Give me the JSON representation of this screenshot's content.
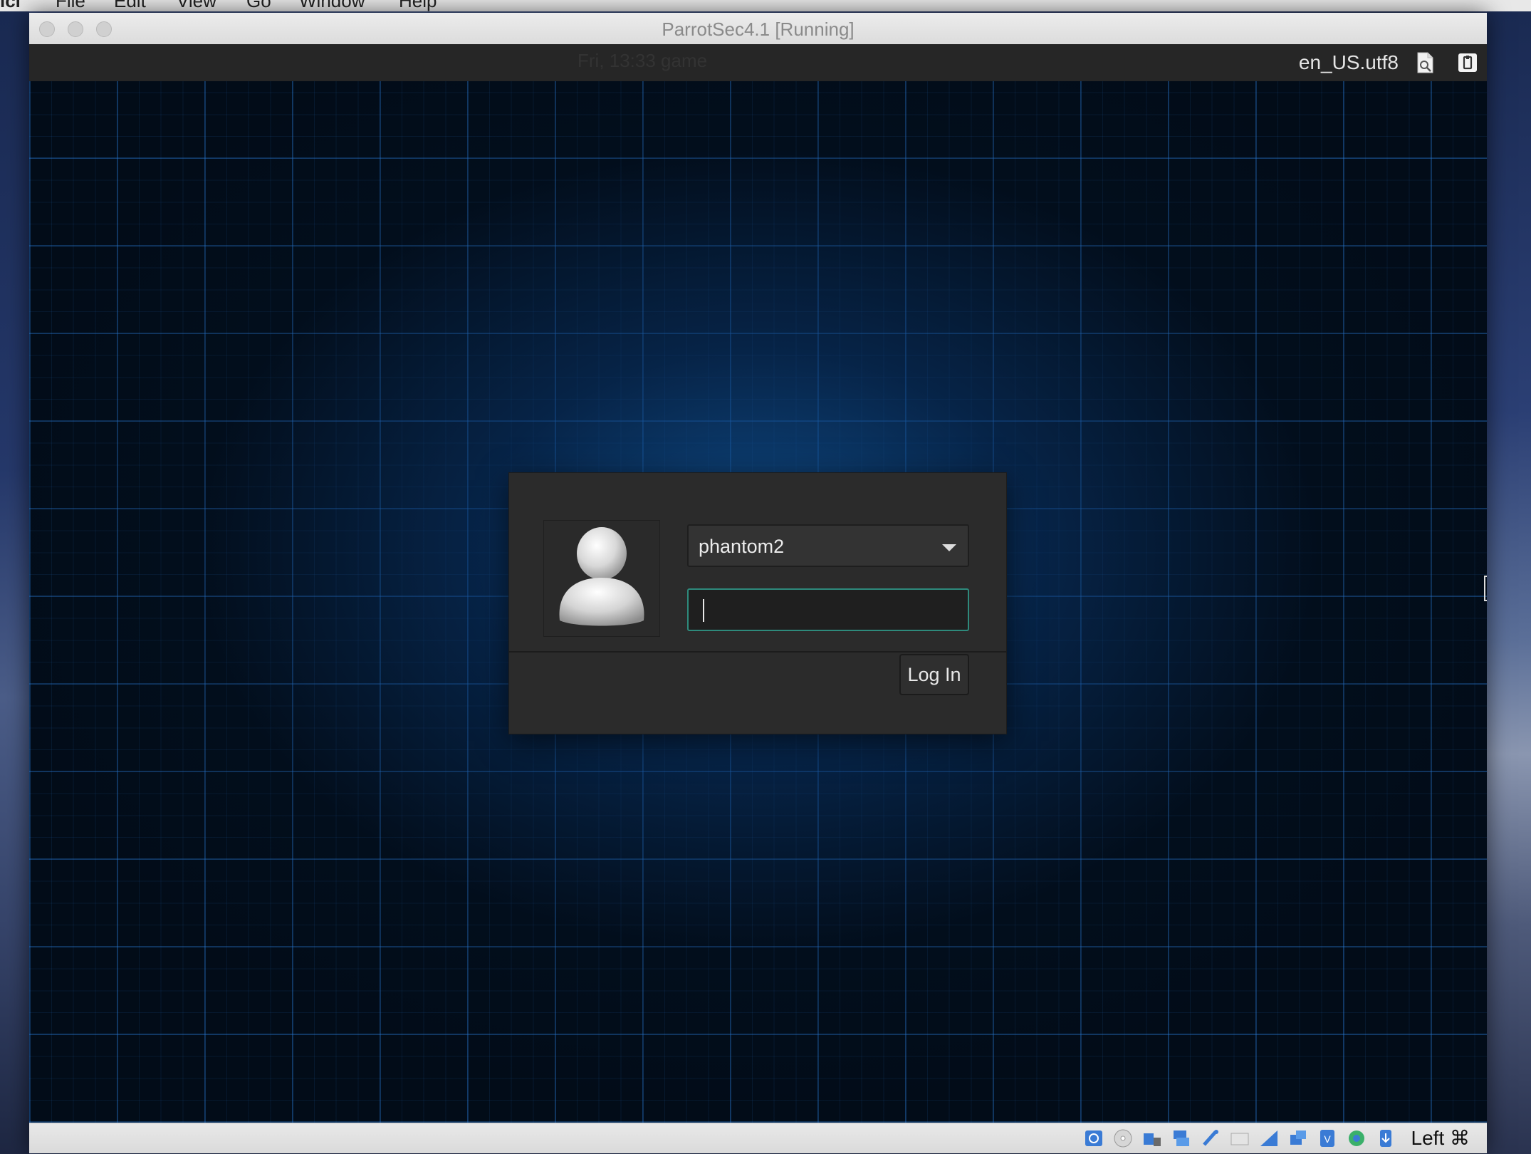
{
  "host_menubar": {
    "app_name": "lcl",
    "items": [
      "File",
      "Edit",
      "View",
      "Go",
      "Window",
      "Help"
    ]
  },
  "window": {
    "title": "ParrotSec4.1 [Running]"
  },
  "guest_panel": {
    "clock_ghost": "Fri, 13:33 game",
    "locale": "en_US.utf8",
    "icons": [
      "document-icon",
      "power-icon"
    ]
  },
  "login": {
    "username": "phantom2",
    "password_value": "",
    "login_label": "Log In"
  },
  "statusbar": {
    "icons": [
      "hard-disk-icon",
      "optical-drive-icon",
      "audio-icon",
      "network-icon",
      "usb-icon",
      "shared-folders-icon",
      "display-icon",
      "video-capture-icon",
      "cpu-icon",
      "guest-additions-icon",
      "mouse-integration-icon"
    ],
    "host_key": "Left ⌘"
  },
  "colors": {
    "accent_focus": "#2e8a7c",
    "grid_blue": "#2878d2",
    "dialog_bg": "#2b2b2b"
  }
}
